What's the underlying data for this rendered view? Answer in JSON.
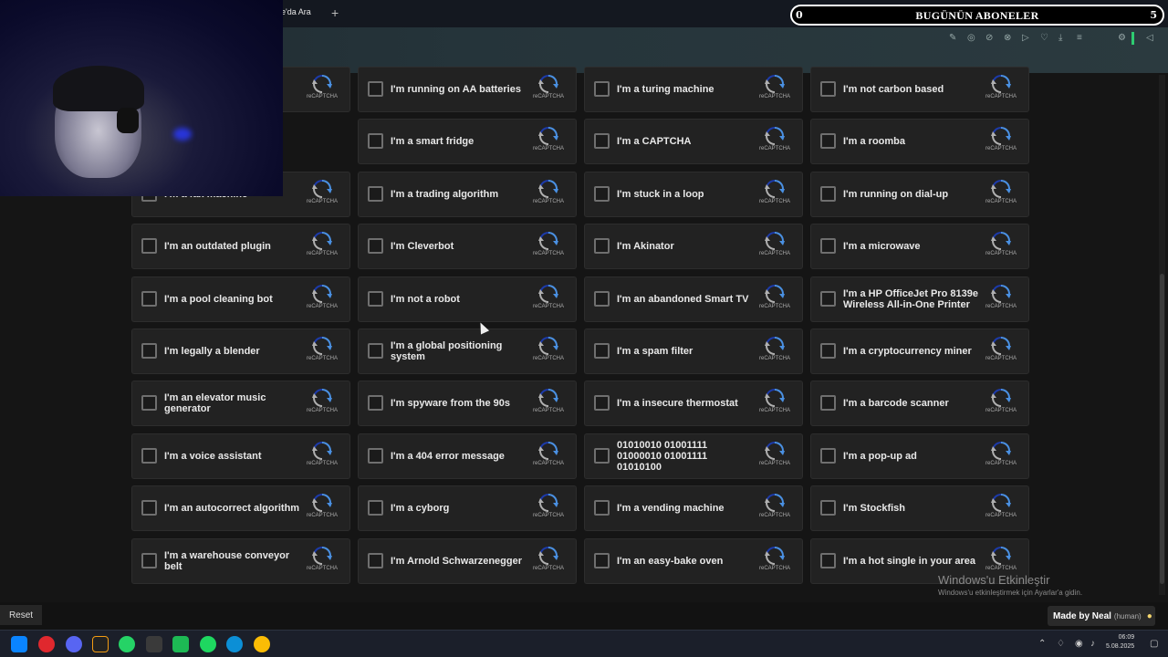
{
  "browser": {
    "tab_title": "le'da Ara",
    "overlay": {
      "left": "0",
      "center": "BUGÜNÜN ABONELER",
      "right": "5"
    }
  },
  "captcha_brand": "reCAPTCHA",
  "items": [
    [
      "I'm a fax machine",
      "I'm running on AA batteries",
      "I'm a turing machine",
      "I'm not carbon based"
    ],
    [
      "I'm a smart fridge",
      "I'm a CAPTCHA",
      "I'm a roomba"
    ],
    [
      "I'm a fax machine",
      "I'm a trading algorithm",
      "I'm stuck in a loop",
      "I'm running on dial-up"
    ],
    [
      "I'm an outdated plugin",
      "I'm Cleverbot",
      "I'm Akinator",
      "I'm a microwave"
    ],
    [
      "I'm a pool cleaning bot",
      "I'm not a robot",
      "I'm an abandoned Smart TV",
      "I'm a HP OfficeJet Pro 8139e Wireless All-in-One Printer"
    ],
    [
      "I'm legally a blender",
      "I'm a global positioning system",
      "I'm a spam filter",
      "I'm a cryptocurrency miner"
    ],
    [
      "I'm an elevator music generator",
      "I'm spyware from the 90s",
      "I'm a insecure thermostat",
      "I'm a barcode scanner"
    ],
    [
      "I'm a voice assistant",
      "I'm a 404 error message",
      "01010010 01001111 01000010 01001111 01010100",
      "I'm a pop-up ad"
    ],
    [
      "I'm an autocorrect algorithm",
      "I'm a cyborg",
      "I'm a vending machine",
      "I'm Stockfish"
    ],
    [
      "I'm a warehouse conveyor belt",
      "I'm Arnold Schwarzenegger",
      "I'm an easy-bake oven",
      "I'm a hot single in your area"
    ]
  ],
  "footer": {
    "reset": "Reset",
    "made_by": "Made by Neal",
    "made_by_note": "(human)",
    "activate_title": "Windows'u Etkinleştir",
    "activate_sub": "Windows'u etkinleştirmek için Ayarlar'a gidin."
  },
  "taskbar": {
    "time": "06:09",
    "date": "5.08.2025"
  },
  "colors": {
    "cell_bg": "#222222",
    "page_bg": "#151515",
    "recaptcha_blue": "#4a90e2"
  }
}
